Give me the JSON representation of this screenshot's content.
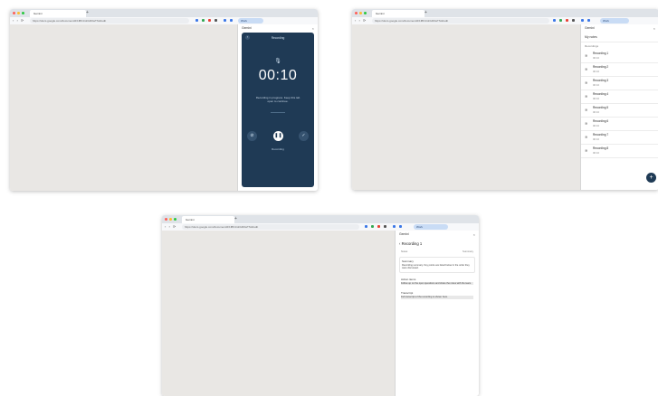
{
  "colors": {
    "window_bg": "#ffffff",
    "content_bg": "#e9e7e4",
    "recorder_bg": "#1f3a55",
    "accent_blue": "#c9dcf5",
    "dot_red": "#ff5f57",
    "dot_yellow": "#febc2e",
    "dot_green": "#28c840",
    "ext_red": "#e94235",
    "ext_blue": "#3b78e7",
    "ext_green": "#34a853"
  },
  "windows": [
    {
      "id": "recording",
      "tab_label": "Gemini",
      "url": "https://docs.google.com/document/d/1f8K4mDxR0wTSt2/edit",
      "account_label": "Work",
      "panel_title": "Gemini",
      "recorder": {
        "header": "Recording",
        "mic_icon": "mic-icon",
        "time": "00:10",
        "message": "Recording in progress. Keep this tab open to continue.",
        "state": "Recording"
      }
    },
    {
      "id": "list",
      "tab_label": "Gemini",
      "url": "https://docs.google.com/document/d/1f8K4mDxR0wTSt2/edit",
      "account_label": "Work",
      "panel_title": "Gemini",
      "list_header": "My notes",
      "list_subheader": "Recordings",
      "items": [
        {
          "title": "Recording 1",
          "sub": "00:10"
        },
        {
          "title": "Recording 2",
          "sub": "00:10"
        },
        {
          "title": "Recording 3",
          "sub": "00:10"
        },
        {
          "title": "Recording 4",
          "sub": "00:10"
        },
        {
          "title": "Recording 5",
          "sub": "00:10"
        },
        {
          "title": "Recording 6",
          "sub": "00:10"
        },
        {
          "title": "Recording 7",
          "sub": "00:10"
        },
        {
          "title": "Recording 8",
          "sub": "00:10"
        }
      ],
      "fab_label": "+"
    },
    {
      "id": "detail",
      "tab_label": "Gemini",
      "url": "https://docs.google.com/document/d/1f8K4mDxR0wTSt2/edit",
      "account_label": "Work",
      "panel_title": "Gemini",
      "detail_title": "Recording 1",
      "meta_left": "Notes",
      "meta_right": "Summary",
      "sections": [
        {
          "heading": "Summary",
          "text": "Recording summary. Key points are listed below in the order they were discussed."
        },
        {
          "heading": "Action items",
          "text": "Follow up on the open questions and share the notes with the team."
        },
        {
          "heading": "Transcript",
          "text": "Full transcript of the recording is shown here."
        }
      ]
    }
  ]
}
